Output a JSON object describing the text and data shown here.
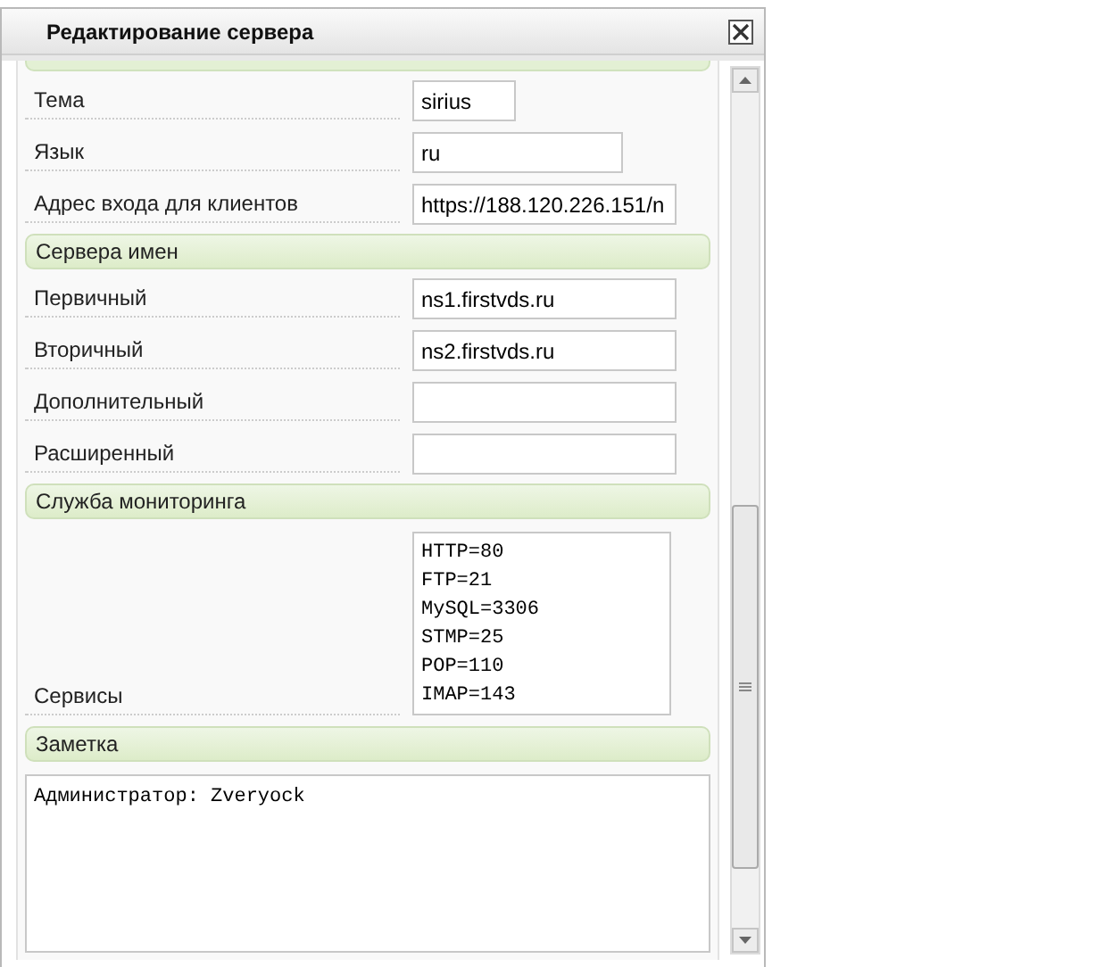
{
  "dialog": {
    "title": "Редактирование сервера"
  },
  "top_fields": [
    {
      "label": "Тема",
      "value": "sirius"
    },
    {
      "label": "Язык",
      "value": "ru"
    },
    {
      "label": "Адрес входа для клиентов",
      "value": "https://188.120.226.151/n"
    }
  ],
  "sections": [
    {
      "title": "Сервера имен",
      "fields": [
        {
          "kind": "text",
          "label": "Первичный",
          "value": "ns1.firstvds.ru"
        },
        {
          "kind": "text",
          "label": "Вторичный",
          "value": "ns2.firstvds.ru"
        },
        {
          "kind": "text",
          "label": "Дополнительный"
        },
        {
          "kind": "text",
          "label": "Расширенный"
        }
      ]
    },
    {
      "title": "Служба мониторинга",
      "fields": [
        {
          "kind": "lines",
          "label": "Сервисы",
          "lines": [
            "HTTP=80",
            "FTP=21",
            "MySQL=3306",
            "STMP=25",
            "POP=110",
            "IMAP=143"
          ]
        }
      ]
    },
    {
      "title": "Заметка",
      "fields": [
        {
          "kind": "note",
          "value": "Администратор: Zveryock"
        }
      ]
    }
  ]
}
